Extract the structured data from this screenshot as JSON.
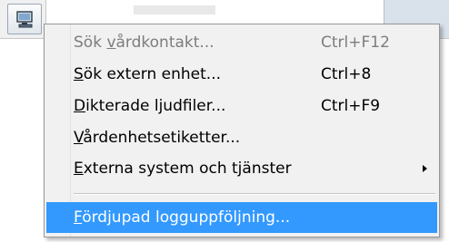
{
  "menu": {
    "items": [
      {
        "pre": "Sök ",
        "mnemonic": "v",
        "post": "årdkontakt...",
        "shortcut": "Ctrl+F12",
        "enabled": false
      },
      {
        "pre": "",
        "mnemonic": "S",
        "post": "ök extern enhet...",
        "shortcut": "Ctrl+8",
        "enabled": true
      },
      {
        "pre": "",
        "mnemonic": "D",
        "post": "ikterade ljudfiler...",
        "shortcut": "Ctrl+F9",
        "enabled": true
      },
      {
        "pre": "",
        "mnemonic": "V",
        "post": "årdenhetsetiketter...",
        "shortcut": "",
        "enabled": true
      },
      {
        "pre": "",
        "mnemonic": "E",
        "post": "xterna system och tjänster",
        "shortcut": "",
        "enabled": true,
        "submenu": true
      },
      {
        "pre": "",
        "mnemonic": "F",
        "post": "ördjupad logguppföljning...",
        "shortcut": "",
        "enabled": true,
        "highlighted": true
      }
    ]
  },
  "colors": {
    "menu_background": "#f1f1f1",
    "highlight": "#3399ff",
    "disabled_text": "#7d7d7d"
  },
  "icons": {
    "app_button_icon": "computer-monitor-icon",
    "submenu_arrow": "chevron-right-icon"
  }
}
